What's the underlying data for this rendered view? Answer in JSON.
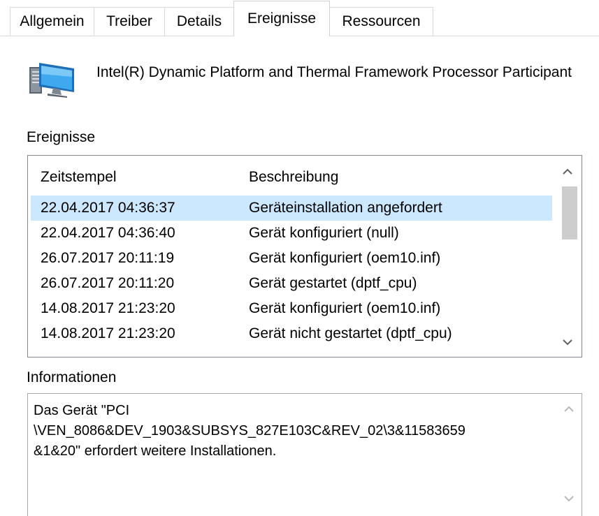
{
  "tabs": [
    {
      "label": "Allgemein",
      "active": false
    },
    {
      "label": "Treiber",
      "active": false
    },
    {
      "label": "Details",
      "active": false
    },
    {
      "label": "Ereignisse",
      "active": true
    },
    {
      "label": "Ressourcen",
      "active": false
    }
  ],
  "device": {
    "icon": "monitor-computer-icon",
    "name": "Intel(R) Dynamic Platform and Thermal Framework Processor Participant"
  },
  "events": {
    "group_label": "Ereignisse",
    "columns": {
      "time": "Zeitstempel",
      "description": "Beschreibung"
    },
    "rows": [
      {
        "time": "22.04.2017 04:36:37",
        "description": "Geräteinstallation angefordert",
        "selected": true
      },
      {
        "time": "22.04.2017 04:36:40",
        "description": "Gerät konfiguriert (null)",
        "selected": false
      },
      {
        "time": "26.07.2017 20:11:19",
        "description": "Gerät konfiguriert (oem10.inf)",
        "selected": false
      },
      {
        "time": "26.07.2017 20:11:20",
        "description": "Gerät gestartet (dptf_cpu)",
        "selected": false
      },
      {
        "time": "14.08.2017 21:23:20",
        "description": "Gerät konfiguriert (oem10.inf)",
        "selected": false
      },
      {
        "time": "14.08.2017 21:23:20",
        "description": "Gerät nicht gestartet (dptf_cpu)",
        "selected": false
      }
    ]
  },
  "information": {
    "group_label": "Informationen",
    "text": "Das Gerät \"PCI\n\\VEN_8086&DEV_1903&SUBSYS_827E103C&REV_02\\3&11583659\n&1&20\" erfordert weitere Installationen."
  },
  "colors": {
    "selection": "#cce8ff",
    "list_border": "#828790",
    "tab_border": "#d9d9d9",
    "scroll_thumb": "#cdcdcd"
  }
}
